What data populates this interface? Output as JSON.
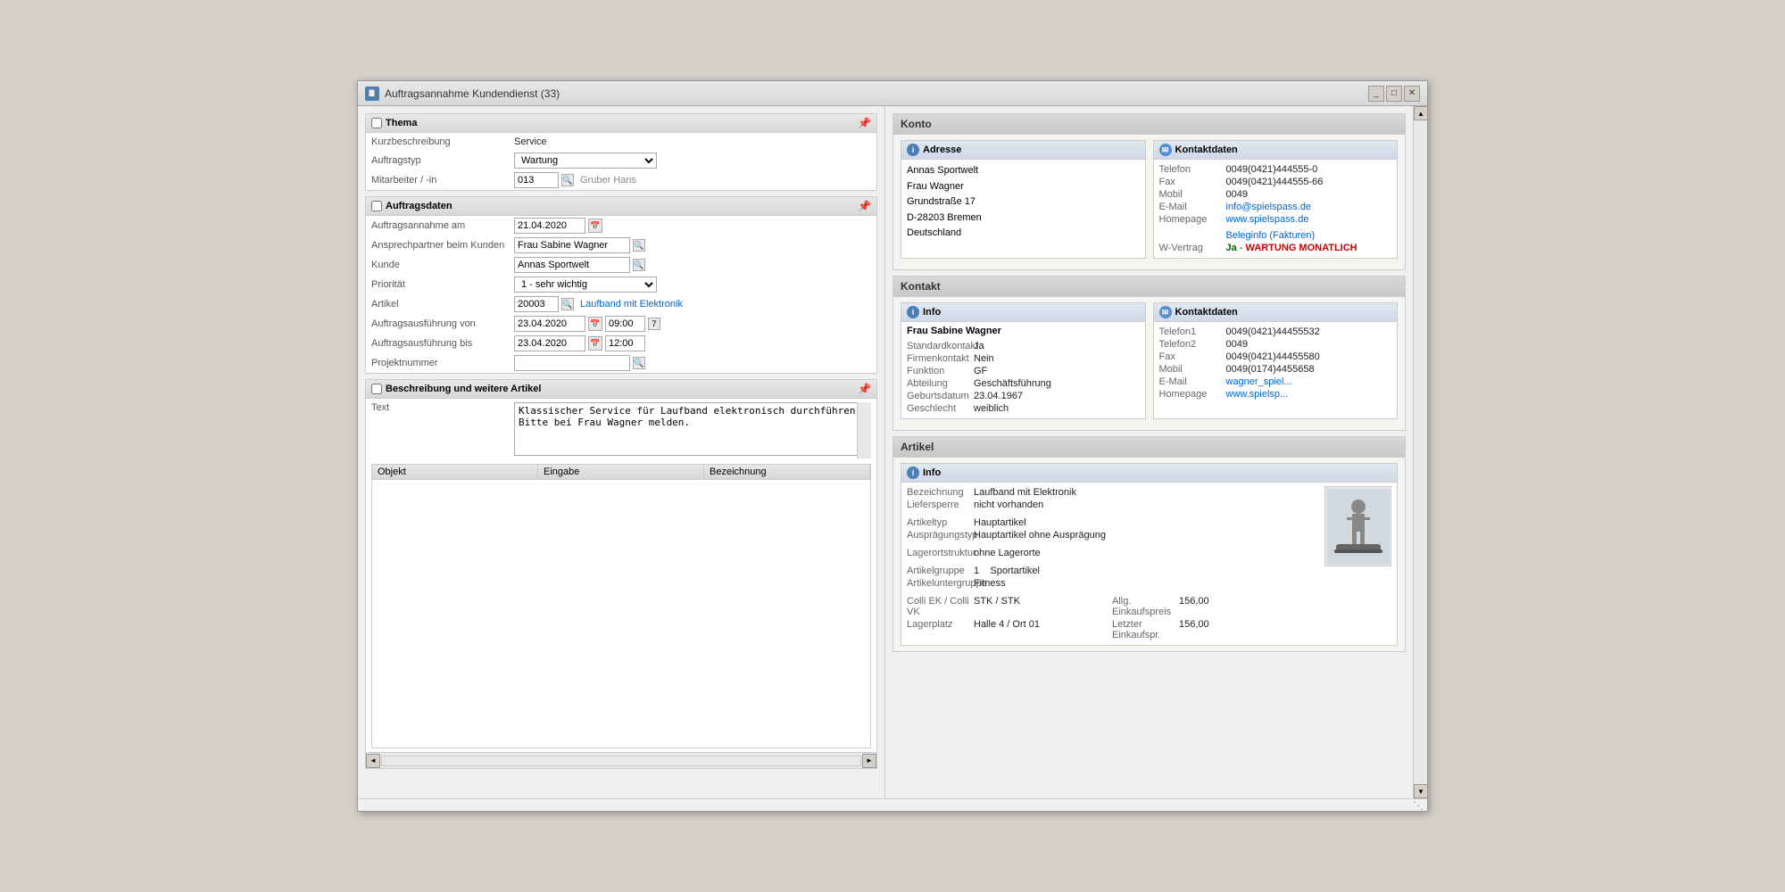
{
  "window": {
    "title": "Auftragsannahme Kundendienst (33)",
    "icon": "📋"
  },
  "thema": {
    "header": "Thema",
    "kurzbeschreibung_label": "Kurzbeschreibung",
    "kurzbeschreibung_value": "Service",
    "auftragstyp_label": "Auftragstyp",
    "auftragstyp_value": "Wartung",
    "mitarbeiter_label": "Mitarbeiter / -in",
    "mitarbeiter_id": "013",
    "mitarbeiter_name": "Gruber Hans"
  },
  "auftragsdaten": {
    "header": "Auftragsdaten",
    "auftragsannahme_label": "Auftragsannahme am",
    "auftragsannahme_value": "21.04.2020",
    "ansprechpartner_label": "Ansprechpartner beim Kunden",
    "ansprechpartner_value": "Frau Sabine Wagner",
    "kunde_label": "Kunde",
    "kunde_value": "Annas Sportwelt",
    "prioritaet_label": "Priorität",
    "prioritaet_value": "1 - sehr wichtig",
    "artikel_label": "Artikel",
    "artikel_id": "20003",
    "artikel_name": "Laufband mit Elektronik",
    "ausfuehrung_von_label": "Auftragsausführung von",
    "ausfuehrung_von_date": "23.04.2020",
    "ausfuehrung_von_time": "09:00",
    "ausfuehrung_bis_label": "Auftragsausführung bis",
    "ausfuehrung_bis_date": "23.04.2020",
    "ausfuehrung_bis_time": "12:00",
    "projektnummer_label": "Projektnummer"
  },
  "beschreibung": {
    "header": "Beschreibung und weitere Artikel",
    "text_label": "Text",
    "text_value": "Klassischer Service für Laufband elektronisch durchführen. Bitte bei Frau Wagner melden.",
    "table": {
      "columns": [
        "Objekt",
        "Eingabe",
        "Bezeichnung"
      ],
      "rows": []
    }
  },
  "konto": {
    "header": "Konto",
    "adresse": {
      "header": "Adresse",
      "firma": "Annas Sportwelt",
      "kontakt": "Frau Wagner",
      "strasse": "Grundstraße 17",
      "ort": "D-28203 Bremen",
      "land": "Deutschland"
    },
    "kontaktdaten": {
      "header": "Kontaktdaten",
      "telefon_label": "Telefon",
      "telefon_value": "0049(0421)444555-0",
      "fax_label": "Fax",
      "fax_value": "0049(0421)444555-66",
      "mobil_label": "Mobil",
      "mobil_value": "0049",
      "email_label": "E-Mail",
      "email_value": "info@spielspass.de",
      "homepage_label": "Homepage",
      "homepage_value": "www.spielspass.de",
      "beleginfo_label": "Beleginfo (Fakturen)",
      "wvertrag_label": "W-Vertrag",
      "wvertrag_value": "Ja - WARTUNG MONATLICH"
    }
  },
  "kontakt": {
    "header": "Kontakt",
    "info": {
      "header": "Info",
      "name": "Frau Sabine Wagner",
      "standardkontakt_label": "Standardkontakt",
      "standardkontakt_value": "Ja",
      "firmenkontakt_label": "Firmenkontakt",
      "firmenkontakt_value": "Nein",
      "funktion_label": "Funktion",
      "funktion_value": "GF",
      "abteilung_label": "Abteilung",
      "abteilung_value": "Geschäftsführung",
      "geburtsdatum_label": "Geburtsdatum",
      "geburtsdatum_value": "23.04.1967",
      "geschlecht_label": "Geschlecht",
      "geschlecht_value": "weiblich"
    },
    "kontaktdaten": {
      "header": "Kontaktdaten",
      "telefon1_label": "Telefon1",
      "telefon1_value": "0049(0421)44455532",
      "telefon2_label": "Telefon2",
      "telefon2_value": "0049",
      "fax_label": "Fax",
      "fax_value": "0049(0421)44455580",
      "mobil_label": "Mobil",
      "mobil_value": "0049(0174)4455658",
      "email_label": "E-Mail",
      "email_value": "wagner_spiel...",
      "homepage_label": "Homepage",
      "homepage_value": "www.spielsp..."
    }
  },
  "artikel": {
    "header": "Artikel",
    "info": {
      "header": "Info",
      "bezeichnung_label": "Bezeichnung",
      "bezeichnung_value": "Laufband mit Elektronik",
      "liefersperre_label": "Liefersperre",
      "liefersperre_value": "nicht vorhanden",
      "artikeltyp_label": "Artikeltyp",
      "artikeltyp_value": "Hauptartikel",
      "auspraegungstyp_label": "Ausprägungstyp",
      "auspraegungstyp_value": "Hauptartikel ohne Ausprägung",
      "lagerortstruktur_label": "Lagerortstruktur",
      "lagerortstruktur_value": "ohne Lagerorte",
      "artikelgruppe_label": "Artikelgruppe",
      "artikelgruppe_number": "1",
      "artikelgruppe_value": "Sportartikel",
      "artikeluntergruppe_label": "Artikeluntergruppe",
      "artikeluntergruppe_value": "Fitness",
      "colli_label": "Colli EK / Colli VK",
      "colli_value": "STK / STK",
      "allg_ep_label": "Allg. Einkaufspreis",
      "allg_ep_value": "156,00",
      "lagerplatz_label": "Lagerplatz",
      "lagerplatz_value": "Halle 4 / Ort 01",
      "letzter_ep_label": "Letzter Einkaufspr.",
      "letzter_ep_value": "156,00"
    }
  },
  "scrollbar": {
    "up": "▲",
    "down": "▼",
    "left": "◄",
    "right": "►"
  }
}
